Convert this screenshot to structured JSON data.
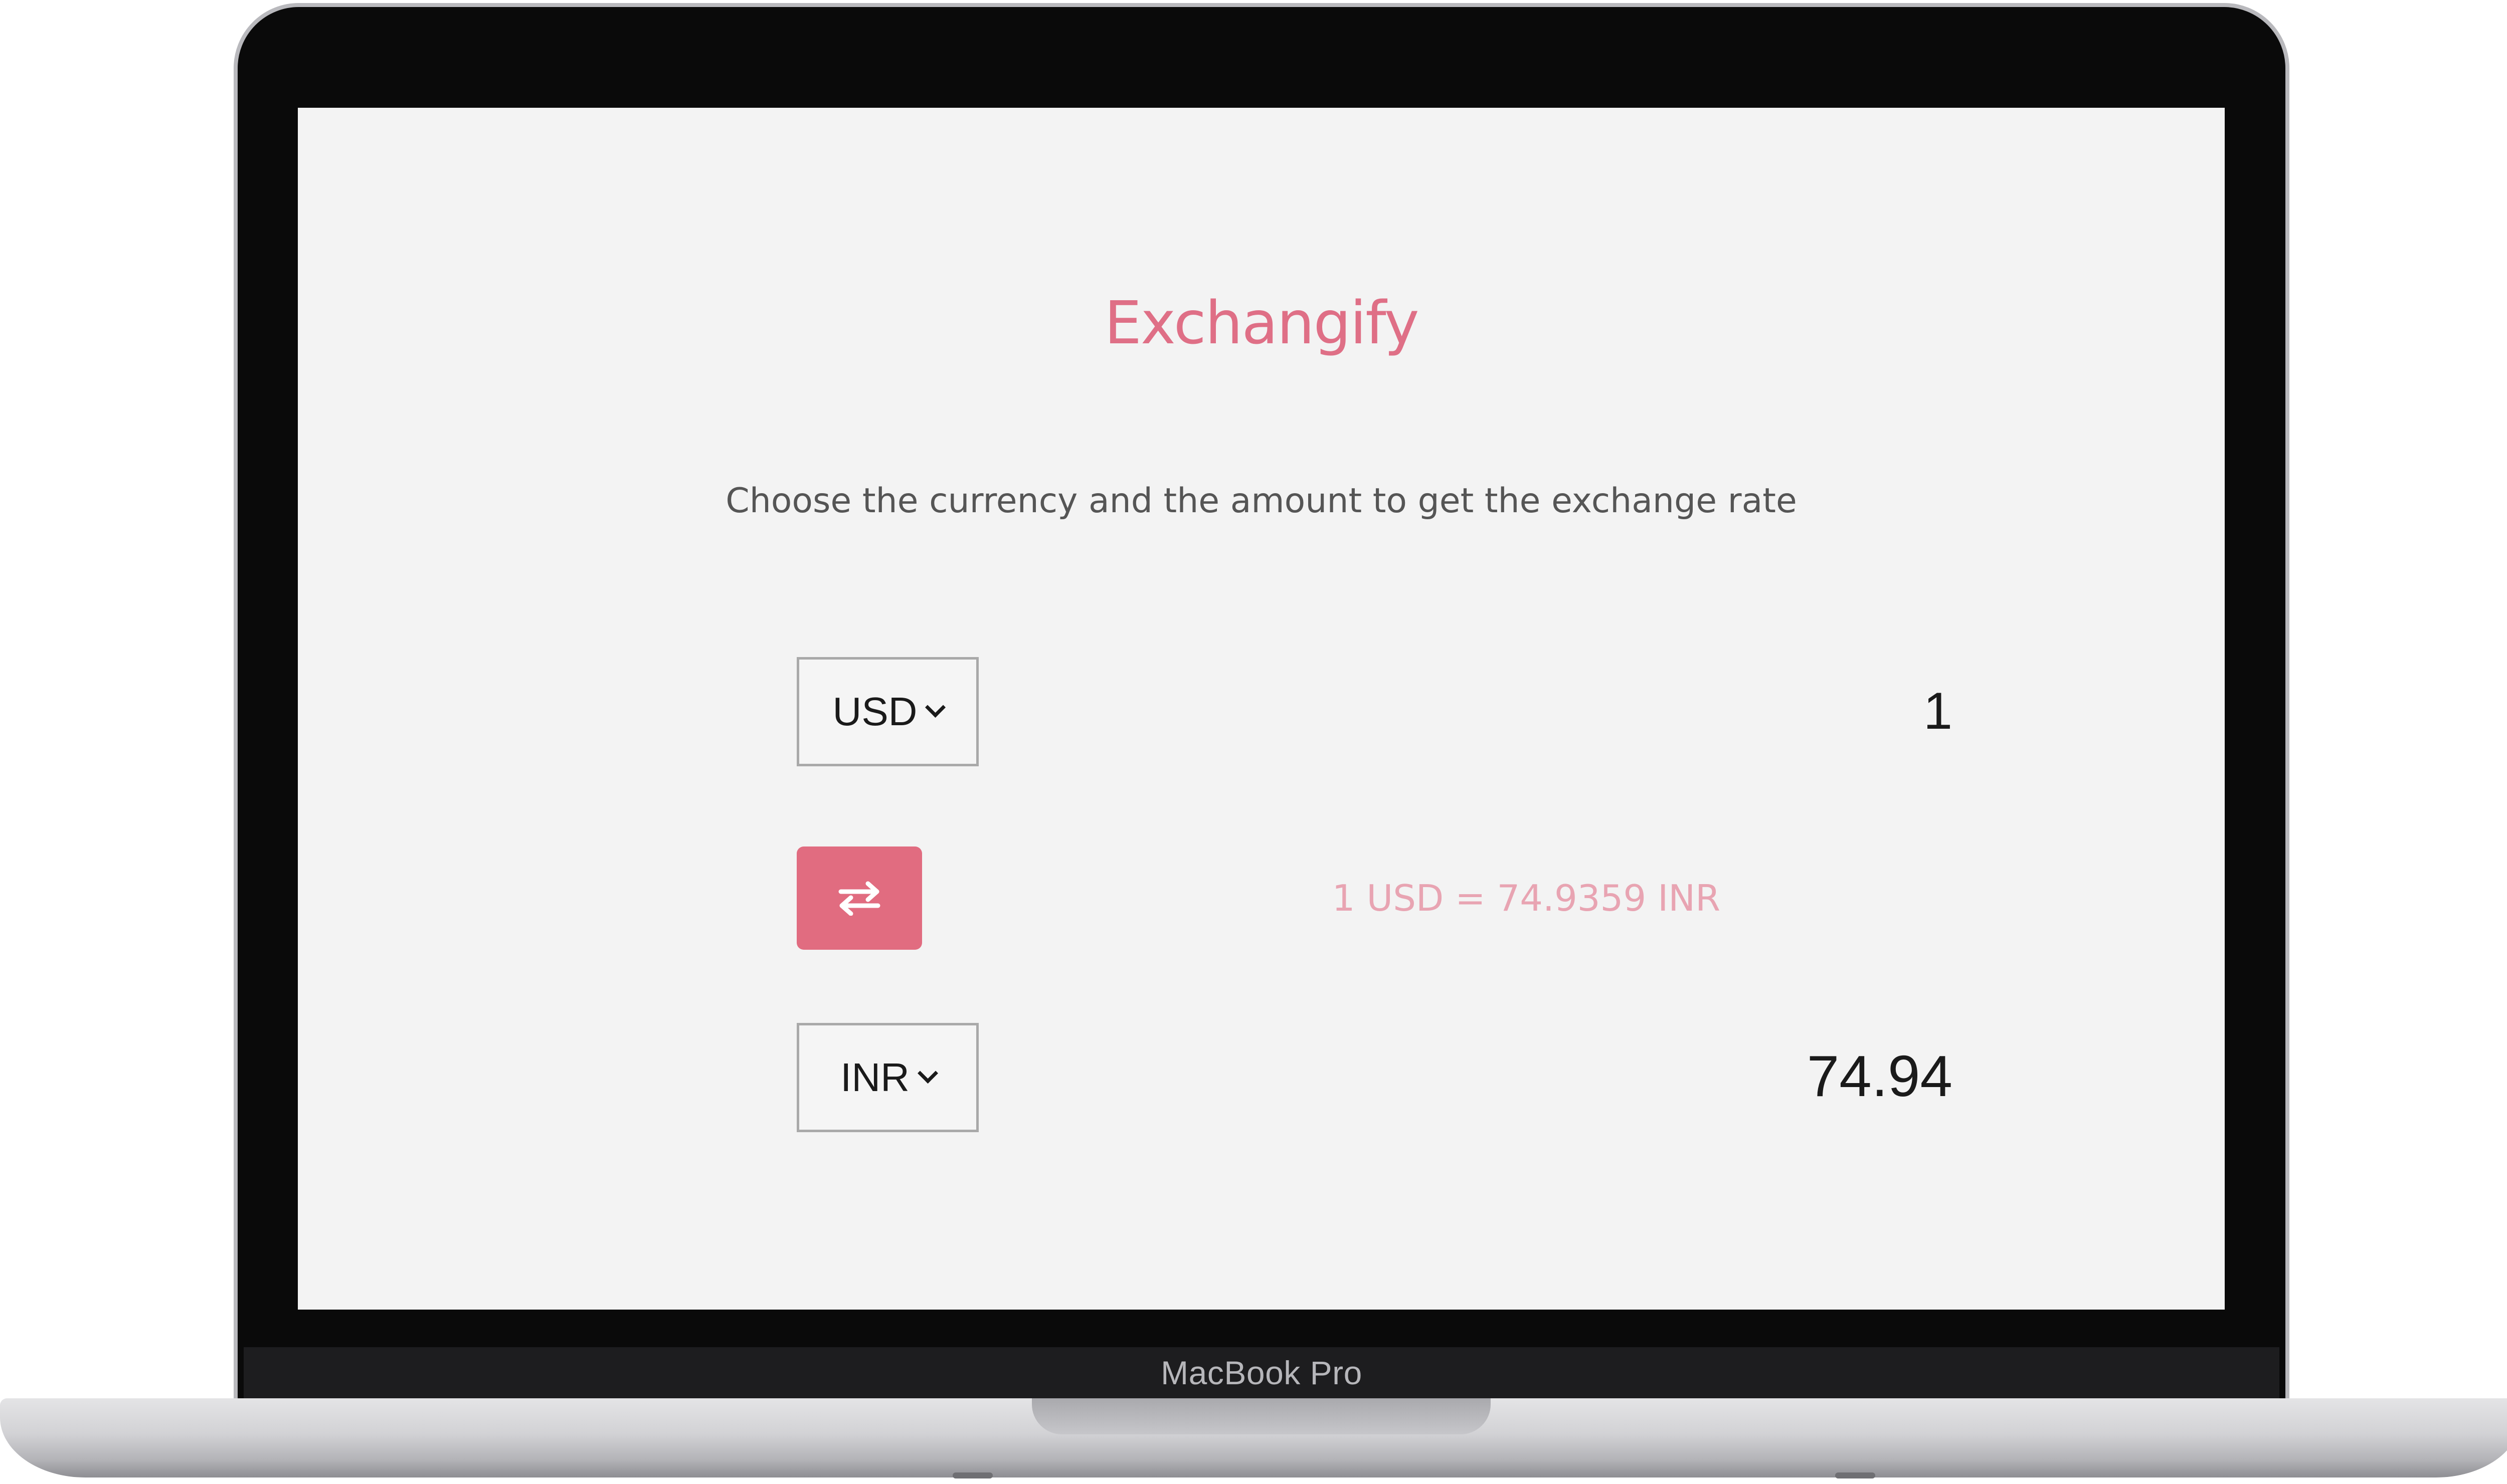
{
  "app": {
    "title": "Exchangify",
    "subtitle": "Choose the currency and the amount to get the exchange rate"
  },
  "from": {
    "currency": "USD",
    "amount": "1"
  },
  "to": {
    "currency": "INR",
    "amount": "74.94"
  },
  "rate_text": "1 USD = 74.9359 INR",
  "device_label": "MacBook Pro",
  "colors": {
    "accent": "#e16c80",
    "title": "#df6f86",
    "rate": "#e8a4b2",
    "screen_bg": "#f3f3f3"
  },
  "icons": {
    "swap": "swap-arrows-icon",
    "dropdown": "chevron-down-icon"
  }
}
